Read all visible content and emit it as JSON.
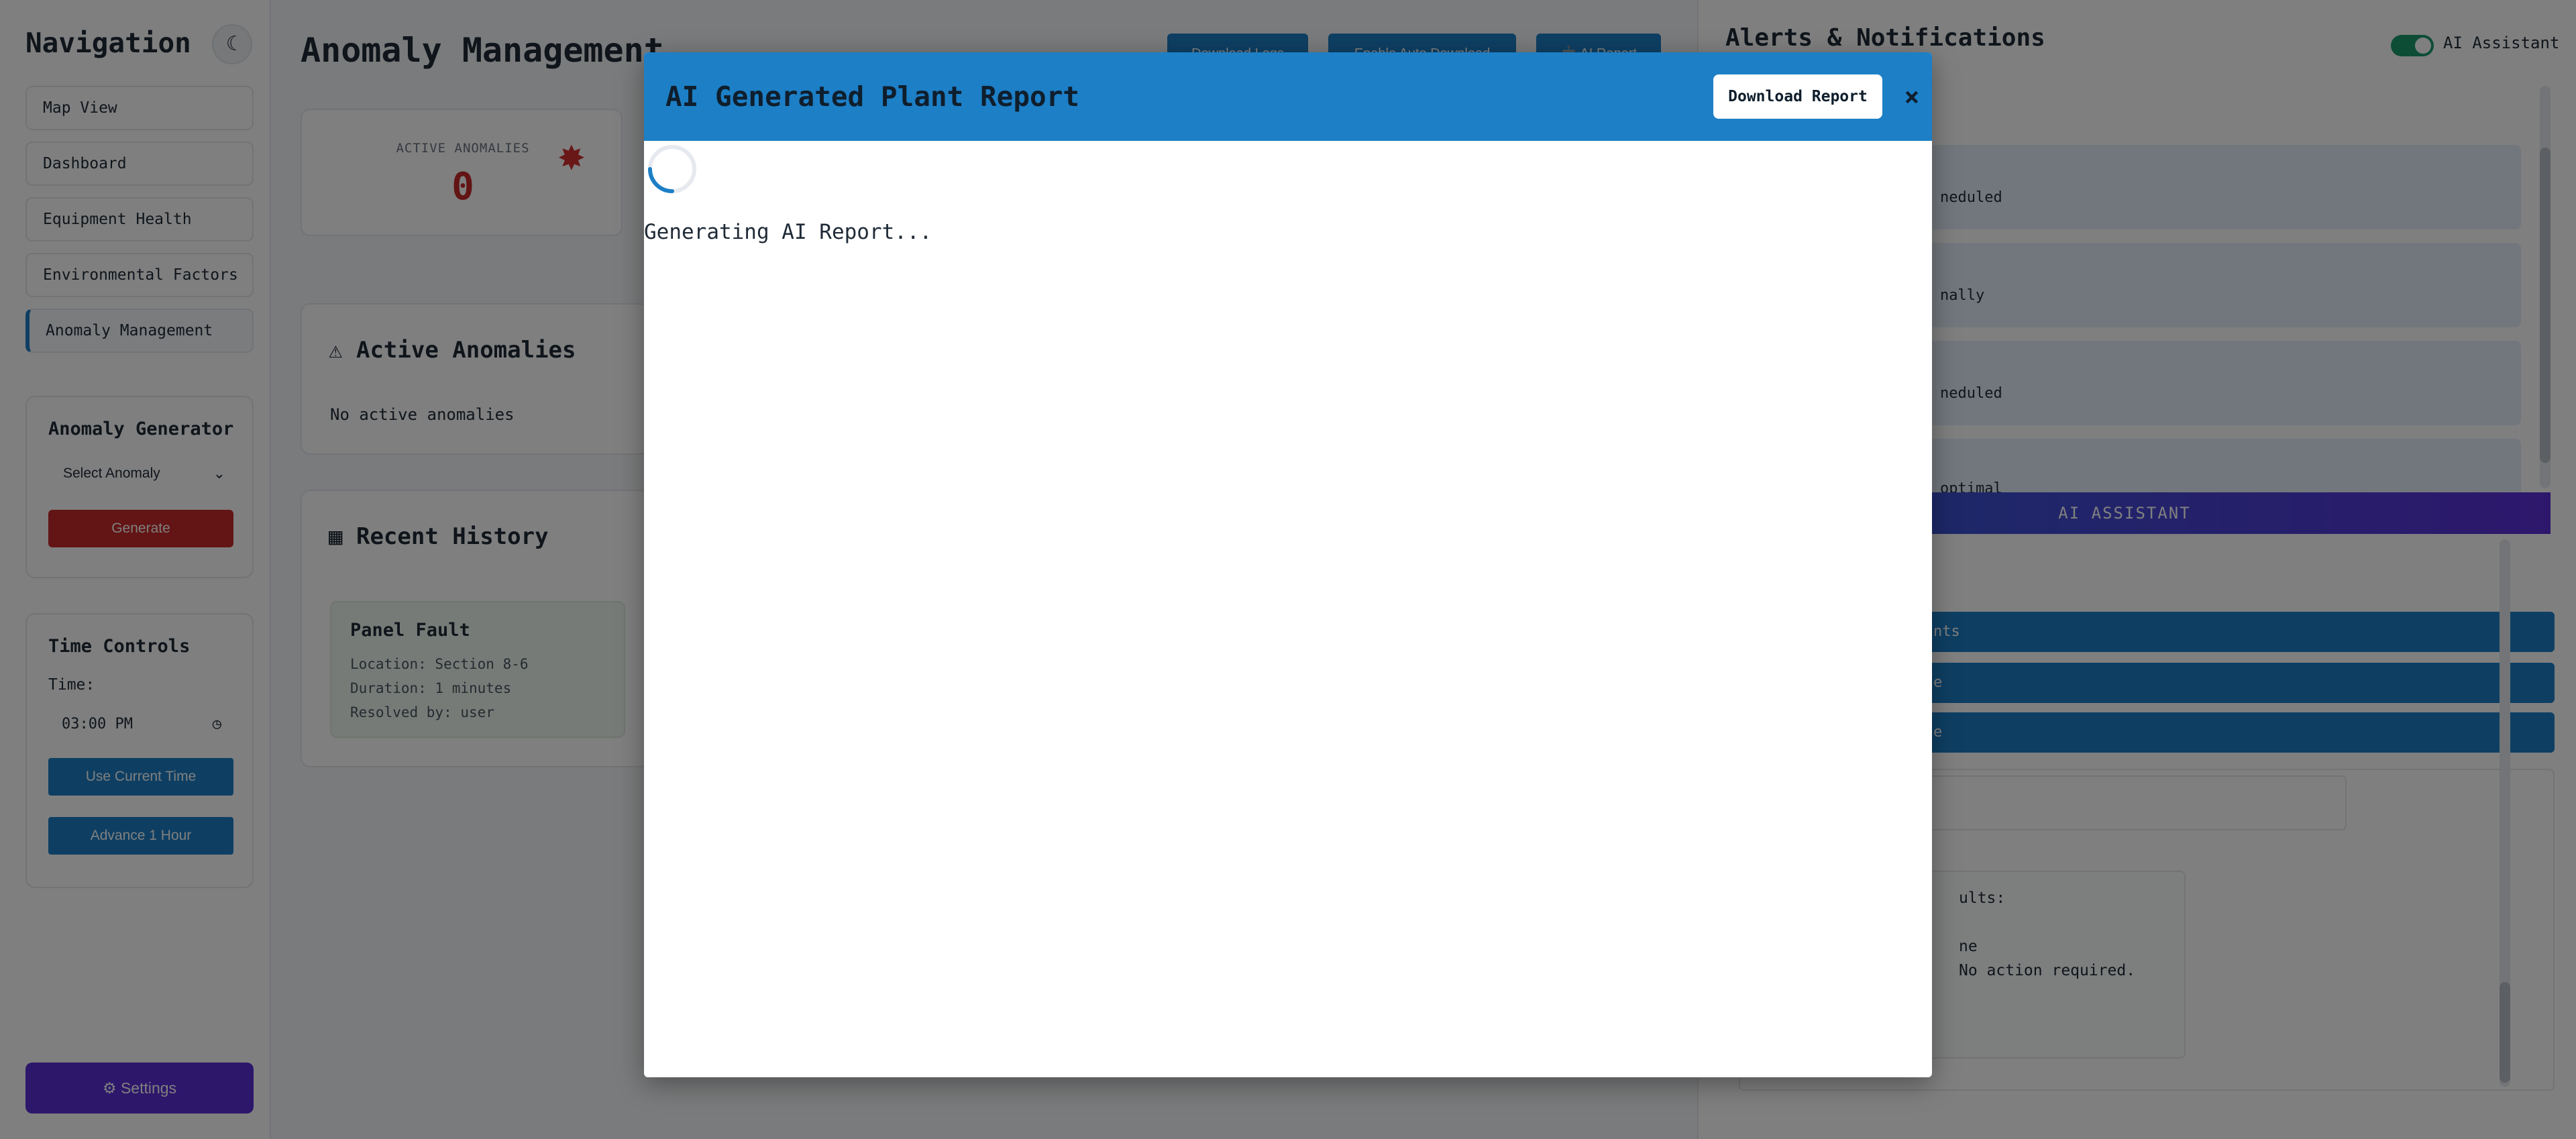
{
  "sidebar": {
    "title": "Navigation",
    "theme_icon": "moon-icon",
    "items": [
      {
        "label": "Map View"
      },
      {
        "label": "Dashboard"
      },
      {
        "label": "Equipment Health"
      },
      {
        "label": "Environmental Factors"
      },
      {
        "label": "Anomaly Management"
      }
    ],
    "active_item": "Anomaly Management",
    "generator": {
      "title": "Anomaly Generator",
      "select_value": "Select Anomaly",
      "generate_label": "Generate"
    },
    "time_controls": {
      "title": "Time Controls",
      "time_label": "Time:",
      "time_value": "03:00 PM",
      "use_current_label": "Use Current Time",
      "advance_label": "Advance 1 Hour"
    },
    "settings_label": "⚙ Settings"
  },
  "main": {
    "title": "Anomaly Management",
    "top_buttons": [
      {
        "label": "Download Logs"
      },
      {
        "label": "Enable Auto Download"
      },
      {
        "label": "🤖 AI Report"
      }
    ],
    "stat": {
      "label": "ACTIVE ANOMALIES",
      "value": "0"
    },
    "active_card": {
      "title": "Active Anomalies",
      "empty_text": "No active anomalies"
    },
    "history_card": {
      "title": "Recent History",
      "item": {
        "title": "Panel Fault",
        "location": "Location: Section 8-6",
        "duration": "Duration: 1 minutes",
        "resolved": "Resolved by: user"
      }
    }
  },
  "right_panel": {
    "title": "Alerts & Notifications",
    "ai_toggle_label": "AI Assistant",
    "ai_toggle_on": true,
    "alerts": [
      {
        "text": "neduled"
      },
      {
        "text": "nally"
      },
      {
        "text": "neduled"
      },
      {
        "text": "optimal"
      }
    ],
    "ai_bar_label": "AI ASSISTANT",
    "quick_buttons": [
      {
        "label": "nts"
      },
      {
        "label": "e"
      },
      {
        "label": "e"
      }
    ],
    "message_lines": [
      {
        "text": "ults:"
      },
      {
        "text": "ne"
      },
      {
        "text": " No action required."
      }
    ]
  },
  "modal": {
    "title": "AI Generated Plant Report",
    "download_label": "Download Report",
    "close_label": "×",
    "loading_text": "Generating AI Report...",
    "spinner_icon": "loading-spinner-icon"
  },
  "colors": {
    "primary": "#1d7fc6",
    "danger": "#c62828",
    "purple": "#5a2ed6",
    "toggle_on": "#1a9b6c"
  }
}
